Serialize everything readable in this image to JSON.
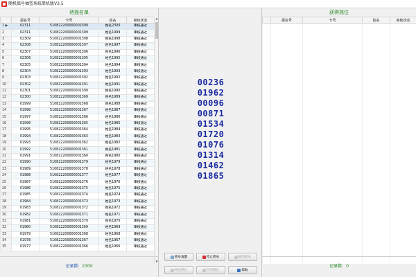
{
  "window": {
    "title": "随机摇号抽签系统单机版V3.5"
  },
  "left": {
    "title": "待摇名单",
    "headers": [
      "",
      "报名号",
      "卡号",
      "姓名",
      "审核状态"
    ],
    "rows": [
      {
        "n": "1",
        "id": "02311",
        "card": "510822200000002300",
        "name": "姓名2300",
        "status": "审核通过"
      },
      {
        "n": "2",
        "id": "02311",
        "card": "510822200000001309",
        "name": "姓名1999",
        "status": "审核通过"
      },
      {
        "n": "3",
        "id": "02309",
        "card": "510822200000001308",
        "name": "姓名1998",
        "status": "审核通过"
      },
      {
        "n": "4",
        "id": "02308",
        "card": "510822200000001307",
        "name": "姓名1997",
        "status": "审核通过"
      },
      {
        "n": "5",
        "id": "02307",
        "card": "510822200000001306",
        "name": "姓名1996",
        "status": "审核通过"
      },
      {
        "n": "6",
        "id": "02306",
        "card": "510822200000001305",
        "name": "姓名1995",
        "status": "审核通过"
      },
      {
        "n": "7",
        "id": "02305",
        "card": "510822200000001304",
        "name": "姓名1994",
        "status": "审核通过"
      },
      {
        "n": "8",
        "id": "02304",
        "card": "510822200000001303",
        "name": "姓名1993",
        "status": "审核通过"
      },
      {
        "n": "9",
        "id": "02303",
        "card": "510822200000001302",
        "name": "姓名1992",
        "status": "审核通过"
      },
      {
        "n": "10",
        "id": "02302",
        "card": "510822200000001301",
        "name": "姓名1991",
        "status": "审核通过"
      },
      {
        "n": "11",
        "id": "02301",
        "card": "510822200000001300",
        "name": "姓名1990",
        "status": "审核通过"
      },
      {
        "n": "12",
        "id": "02300",
        "card": "510822200000001369",
        "name": "姓名1989",
        "status": "审核通过"
      },
      {
        "n": "13",
        "id": "01999",
        "card": "510822200000001368",
        "name": "姓名1988",
        "status": "审核通过"
      },
      {
        "n": "14",
        "id": "01998",
        "card": "510822200000001367",
        "name": "姓名1987",
        "status": "审核通过"
      },
      {
        "n": "15",
        "id": "01997",
        "card": "510822200000001366",
        "name": "姓名1986",
        "status": "审核通过"
      },
      {
        "n": "16",
        "id": "01996",
        "card": "510822200000001365",
        "name": "姓名1985",
        "status": "审核通过"
      },
      {
        "n": "17",
        "id": "01995",
        "card": "510822200000001364",
        "name": "姓名1984",
        "status": "审核通过"
      },
      {
        "n": "18",
        "id": "01994",
        "card": "510822200000001363",
        "name": "姓名1983",
        "status": "审核通过"
      },
      {
        "n": "19",
        "id": "01993",
        "card": "510822200000001362",
        "name": "姓名1982",
        "status": "审核通过"
      },
      {
        "n": "20",
        "id": "01992",
        "card": "510822200000001361",
        "name": "姓名1981",
        "status": "审核通过"
      },
      {
        "n": "21",
        "id": "01991",
        "card": "510822200000001360",
        "name": "姓名1980",
        "status": "审核通过"
      },
      {
        "n": "22",
        "id": "01990",
        "card": "510822200000001379",
        "name": "姓名1979",
        "status": "审核通过"
      },
      {
        "n": "23",
        "id": "01989",
        "card": "510822200000001378",
        "name": "姓名1978",
        "status": "审核通过"
      },
      {
        "n": "24",
        "id": "01988",
        "card": "510822200000001377",
        "name": "姓名1977",
        "status": "审核通过"
      },
      {
        "n": "25",
        "id": "01987",
        "card": "510822200000001376",
        "name": "姓名1976",
        "status": "审核通过"
      },
      {
        "n": "26",
        "id": "01986",
        "card": "510822200000001375",
        "name": "姓名1975",
        "status": "审核通过"
      },
      {
        "n": "27",
        "id": "01985",
        "card": "510822200000001374",
        "name": "姓名1974",
        "status": "审核通过"
      },
      {
        "n": "28",
        "id": "01984",
        "card": "510822200000001373",
        "name": "姓名1973",
        "status": "审核通过"
      },
      {
        "n": "29",
        "id": "01983",
        "card": "510822200000001372",
        "name": "姓名1972",
        "status": "审核通过"
      },
      {
        "n": "30",
        "id": "01982",
        "card": "510822200000001371",
        "name": "姓名1971",
        "status": "审核通过"
      },
      {
        "n": "31",
        "id": "01981",
        "card": "510822200000001370",
        "name": "姓名1970",
        "status": "审核通过"
      },
      {
        "n": "32",
        "id": "01980",
        "card": "510822200000001369",
        "name": "姓名1969",
        "status": "审核通过"
      },
      {
        "n": "33",
        "id": "01979",
        "card": "510822200000001368",
        "name": "姓名1968",
        "status": "审核通过"
      },
      {
        "n": "34",
        "id": "01978",
        "card": "510822200000001367",
        "name": "姓名1967",
        "status": "审核通过"
      },
      {
        "n": "35",
        "id": "01977",
        "card": "510822200000001366",
        "name": "姓名1966",
        "status": "审核通过"
      }
    ],
    "count_label": "记录数:",
    "count_value": "2300"
  },
  "middle": {
    "drawn": [
      "00236",
      "01962",
      "00096",
      "00871",
      "01534",
      "01720",
      "01076",
      "01314",
      "01462",
      "01865"
    ],
    "buttons_row1": [
      {
        "label": "摇号设置",
        "icon": "settings-icon",
        "disabled": false
      },
      {
        "label": "停止摇号",
        "icon": "draw-icon",
        "disabled": false
      },
      {
        "label": "撤回摇号",
        "icon": "undo-icon",
        "disabled": true
      }
    ],
    "buttons_row2": [
      {
        "label": "导出摇位",
        "icon": "export-icon",
        "disabled": true
      },
      {
        "label": "打印摇位",
        "icon": "print-icon",
        "disabled": true
      },
      {
        "label": "帮助",
        "icon": "help-icon",
        "disabled": false
      }
    ]
  },
  "right": {
    "title": "获得摇位",
    "headers": [
      "",
      "报名号",
      "卡号",
      "姓名",
      "审核状态"
    ],
    "count_label": "记录数:",
    "count_value": "0"
  }
}
